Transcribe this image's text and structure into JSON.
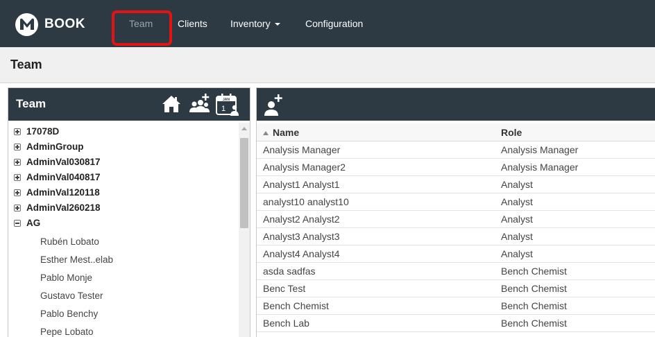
{
  "brand": {
    "logo_text": "BOOK"
  },
  "nav": {
    "items": [
      {
        "label": "Team"
      },
      {
        "label": "Clients"
      },
      {
        "label": "Inventory"
      },
      {
        "label": "Configuration"
      }
    ],
    "active_item": "Team"
  },
  "page": {
    "title": "Team"
  },
  "left_panel": {
    "title": "Team",
    "icons": [
      "home-icon",
      "add-group-icon",
      "calendar-user-icon"
    ],
    "calendar_icon_text": {
      "month": "JAN",
      "day": "1"
    },
    "tree": {
      "groups": [
        {
          "label": "17078D",
          "expanded": false
        },
        {
          "label": "AdminGroup",
          "expanded": false
        },
        {
          "label": "AdminVal030817",
          "expanded": false
        },
        {
          "label": "AdminVal040817",
          "expanded": false
        },
        {
          "label": "AdminVal120118",
          "expanded": false
        },
        {
          "label": "AdminVal260218",
          "expanded": false
        },
        {
          "label": "AG",
          "expanded": true
        }
      ],
      "members": [
        "Rubén Lobato",
        "Esther Mest..elab",
        "Pablo Monje",
        "Gustavo Tester",
        "Pablo Benchy",
        "Pepe Lobato"
      ]
    }
  },
  "right_panel": {
    "toolbar_icons": [
      "add-user-icon"
    ],
    "grid": {
      "columns": [
        "Name",
        "Role"
      ],
      "sort_column": "Name",
      "sort_direction": "ascending",
      "rows": [
        [
          "Analysis Manager",
          "Analysis Manager"
        ],
        [
          "Analysis Manager2",
          "Analysis Manager"
        ],
        [
          "Analyst1 Analyst1",
          "Analyst"
        ],
        [
          "analyst10 analyst10",
          "Analyst"
        ],
        [
          "Analyst2 Analyst2",
          "Analyst"
        ],
        [
          "Analyst3 Analyst3",
          "Analyst"
        ],
        [
          "Analyst4 Analyst4",
          "Analyst"
        ],
        [
          "asda sadfas",
          "Bench Chemist"
        ],
        [
          "Benc Test",
          "Bench Chemist"
        ],
        [
          "Bench Chemist",
          "Bench Chemist"
        ],
        [
          "Bench Lab",
          "Bench Chemist"
        ]
      ]
    }
  },
  "colors": {
    "navbar": "#2d3a44",
    "active_nav_text": "#9aa4ad",
    "highlight_outline": "#e41313",
    "page_header_bg": "#f0f0f0"
  }
}
